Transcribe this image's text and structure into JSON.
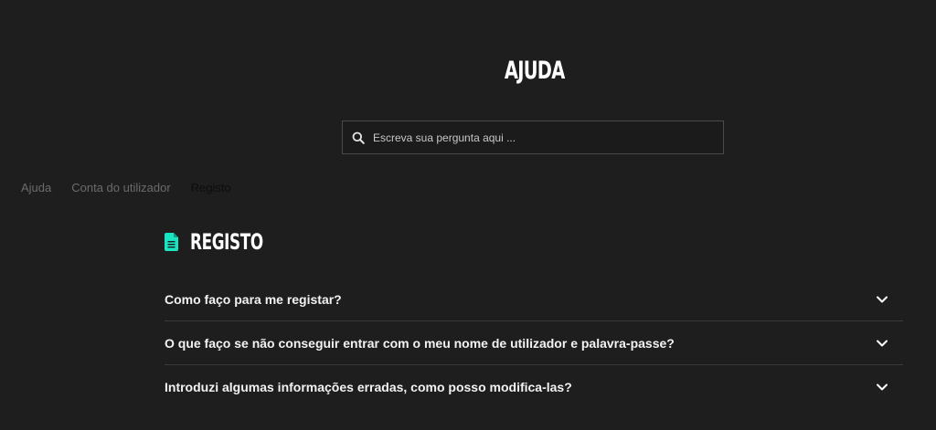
{
  "header": {
    "title": "AJUDA"
  },
  "search": {
    "placeholder": "Escreva sua pergunta aqui ..."
  },
  "breadcrumb": {
    "items": [
      "Ajuda",
      "Conta do utilizador",
      "Registo"
    ]
  },
  "section": {
    "title": "REGISTO",
    "icon": "document-icon",
    "icon_color": "#19e6c1"
  },
  "faq": {
    "items": [
      {
        "question": "Como faço para me registar?"
      },
      {
        "question": "O que faço se não conseguir entrar com o meu nome de utilizador e palavra-passe?"
      },
      {
        "question": "Introduzi algumas informações erradas, como posso modifica-las?"
      }
    ]
  },
  "colors": {
    "background": "#1e1e1e",
    "accent": "#19e6c1",
    "text": "#ffffff",
    "divider": "#3a3a3a"
  }
}
